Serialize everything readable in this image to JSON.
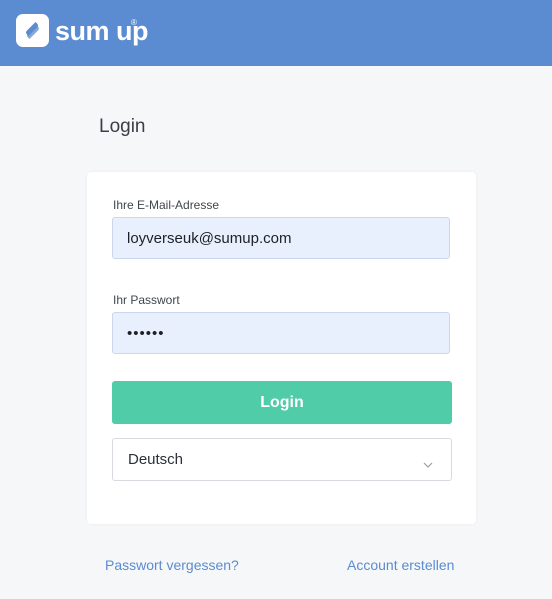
{
  "header": {
    "brand": "sum up",
    "registered_mark": "®",
    "logo_icon": "sumup-logo-icon",
    "background_color": "#5b8bd0"
  },
  "page": {
    "title": "Login"
  },
  "form": {
    "email_label": "Ihre E-Mail-Adresse",
    "email_value": "loyverseuk@sumup.com",
    "password_label": "Ihr Passwort",
    "password_value": "••••••",
    "login_label": "Login",
    "login_color": "#50cca8",
    "language_value": "Deutsch",
    "language_icon": "chevron-down-icon"
  },
  "links": {
    "forgot_password": "Passwort vergessen?",
    "create_account": "Account erstellen"
  }
}
